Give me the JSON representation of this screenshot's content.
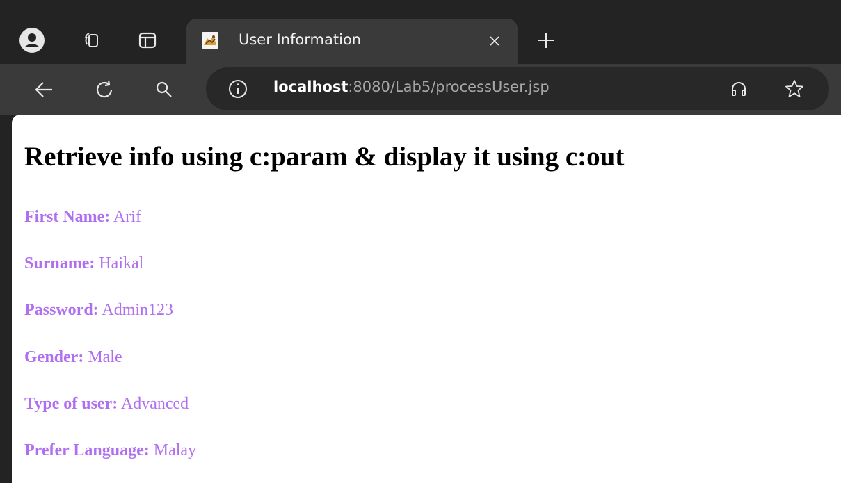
{
  "tab": {
    "title": "User Information",
    "favicon": "tomcat-favicon-icon"
  },
  "address_bar": {
    "host": "localhost",
    "rest": ":8080/Lab5/processUser.jsp"
  },
  "page": {
    "heading": "Retrieve info using c:param & display it using c:out",
    "fields": [
      {
        "label": "First Name:",
        "value": "Arif"
      },
      {
        "label": "Surname:",
        "value": "Haikal"
      },
      {
        "label": "Password:",
        "value": "Admin123"
      },
      {
        "label": "Gender:",
        "value": "Male"
      },
      {
        "label": "Type of user:",
        "value": "Advanced"
      },
      {
        "label": "Prefer Language:",
        "value": "Malay"
      }
    ]
  },
  "colors": {
    "field_text": "#b06ff0",
    "chrome_dark": "#232323",
    "chrome_toolbar": "#3a3a3a",
    "omnibox": "#282828"
  }
}
